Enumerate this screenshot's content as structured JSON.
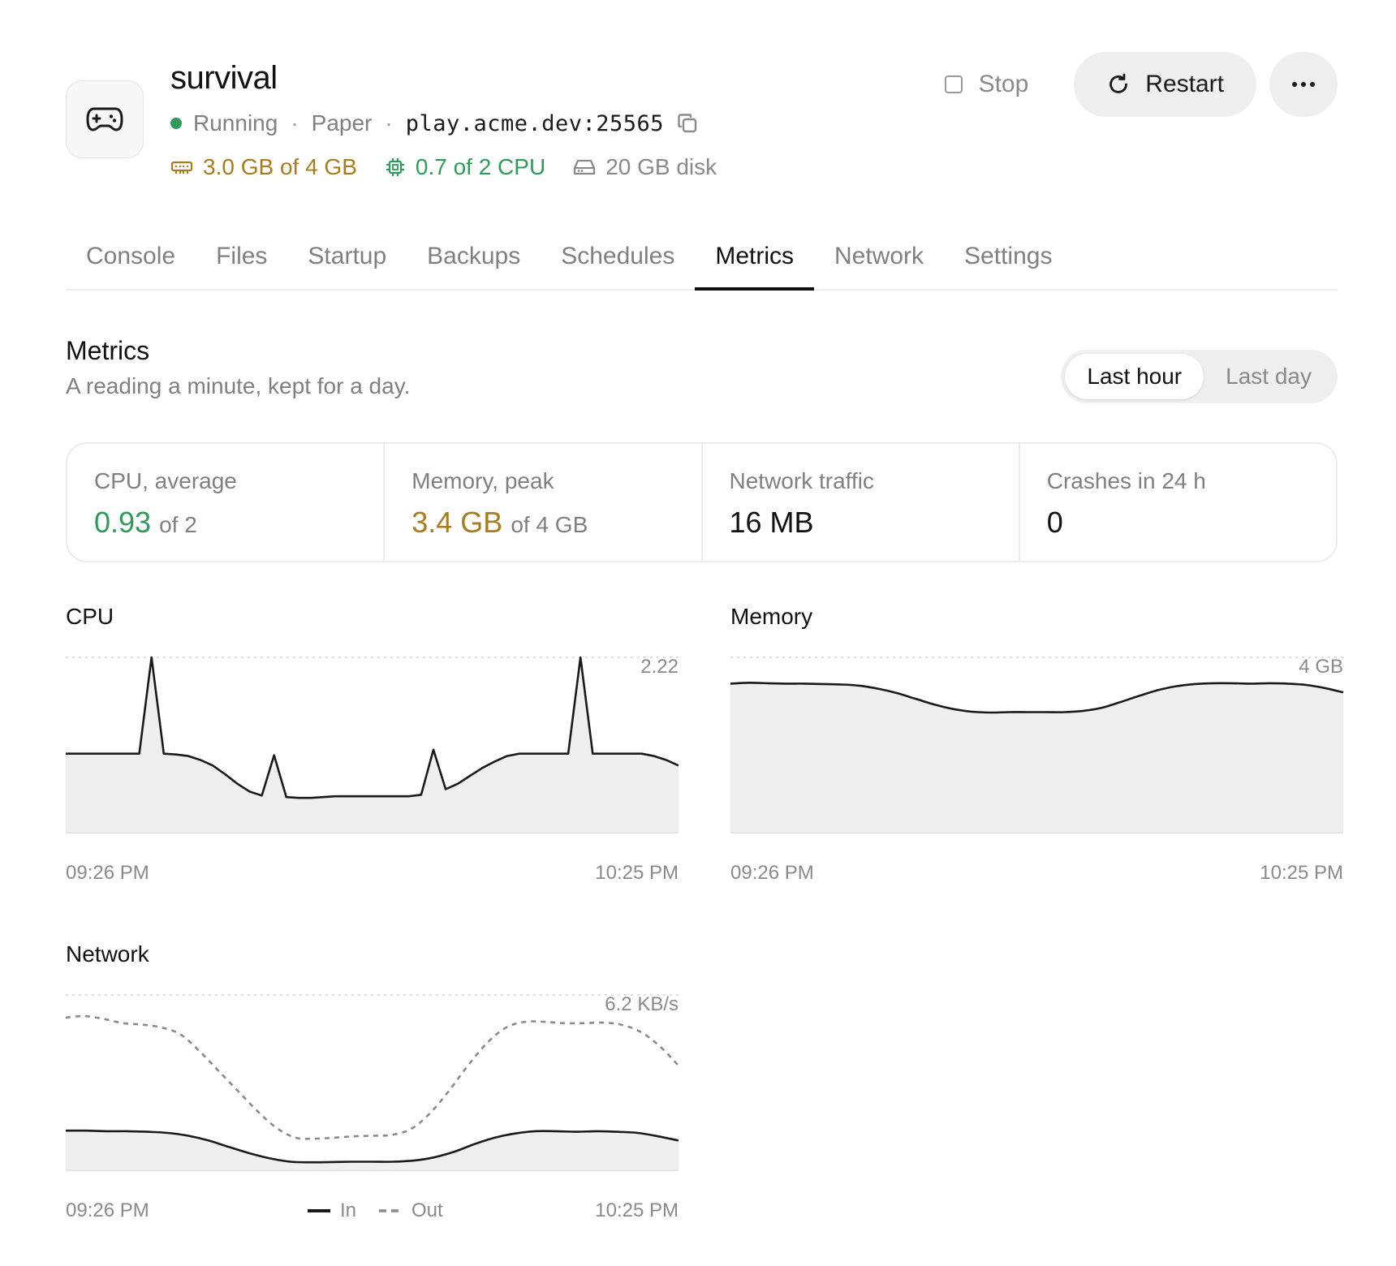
{
  "server": {
    "title": "survival",
    "status": "Running",
    "software": "Paper",
    "address": "play.acme.dev:25565",
    "separator": "·"
  },
  "resources": {
    "memory": "3.0 GB of 4 GB",
    "cpu": "0.7 of 2 CPU",
    "disk": "20 GB disk"
  },
  "actions": {
    "stop_label": "Stop",
    "restart_label": "Restart"
  },
  "tabs": [
    {
      "label": "Console"
    },
    {
      "label": "Files"
    },
    {
      "label": "Startup"
    },
    {
      "label": "Backups"
    },
    {
      "label": "Schedules"
    },
    {
      "label": "Metrics",
      "active": true
    },
    {
      "label": "Network"
    },
    {
      "label": "Settings"
    }
  ],
  "section": {
    "title": "Metrics",
    "subtitle": "A reading a minute, kept for a day.",
    "ranges": [
      "Last hour",
      "Last day"
    ],
    "active_range": "Last hour"
  },
  "stats": [
    {
      "label": "CPU, average",
      "value": "0.93",
      "suffix": "of 2",
      "color": "#2e9b5a"
    },
    {
      "label": "Memory, peak",
      "value": "3.4 GB",
      "suffix": "of 4 GB",
      "color": "#a97c1f"
    },
    {
      "label": "Network traffic",
      "value": "16 MB"
    },
    {
      "label": "Crashes in 24 h",
      "value": "0"
    }
  ],
  "colors": {
    "running": "#2e9b5a",
    "memory": "#a97c1f",
    "cpu": "#2e9b5a",
    "chart_fill": "#efefef",
    "chart_line": "#1a1a1a"
  },
  "chart_data": [
    {
      "type": "area",
      "title": "CPU",
      "max_label": "2.22",
      "x_start": "09:26 PM",
      "x_end": "10:25 PM",
      "ylim": [
        0,
        2.22
      ],
      "values": [
        1.0,
        1.0,
        1.0,
        1.0,
        1.0,
        1.0,
        1.0,
        2.22,
        1.0,
        0.99,
        0.97,
        0.92,
        0.85,
        0.74,
        0.62,
        0.52,
        0.47,
        0.98,
        0.45,
        0.44,
        0.44,
        0.45,
        0.46,
        0.46,
        0.46,
        0.46,
        0.46,
        0.46,
        0.46,
        0.48,
        1.05,
        0.55,
        0.62,
        0.72,
        0.82,
        0.9,
        0.97,
        1.0,
        1.0,
        1.0,
        1.0,
        1.0,
        2.22,
        1.0,
        1.0,
        1.0,
        1.0,
        1.0,
        0.97,
        0.92,
        0.85
      ]
    },
    {
      "type": "area",
      "title": "Memory",
      "max_label": "4 GB",
      "x_start": "09:26 PM",
      "x_end": "10:25 PM",
      "ylim": [
        0,
        4
      ],
      "values": [
        3.4,
        3.42,
        3.41,
        3.4,
        3.4,
        3.39,
        3.38,
        3.35,
        3.28,
        3.18,
        3.05,
        2.92,
        2.82,
        2.76,
        2.74,
        2.75,
        2.75,
        2.75,
        2.75,
        2.78,
        2.85,
        2.98,
        3.12,
        3.25,
        3.34,
        3.39,
        3.41,
        3.41,
        3.4,
        3.41,
        3.4,
        3.37,
        3.3,
        3.2
      ]
    },
    {
      "type": "line",
      "title": "Network",
      "max_label": "6.2 KB/s",
      "x_start": "09:26 PM",
      "x_end": "10:25 PM",
      "ylim": [
        0,
        6.2
      ],
      "series": [
        {
          "name": "In",
          "style": "solid",
          "filled": true,
          "values": [
            1.4,
            1.4,
            1.38,
            1.38,
            1.36,
            1.32,
            1.22,
            1.05,
            0.82,
            0.6,
            0.42,
            0.3,
            0.28,
            0.29,
            0.3,
            0.3,
            0.3,
            0.34,
            0.45,
            0.65,
            0.92,
            1.15,
            1.3,
            1.38,
            1.38,
            1.36,
            1.38,
            1.36,
            1.32,
            1.2,
            1.05
          ]
        },
        {
          "name": "Out",
          "style": "dashed",
          "values": [
            5.4,
            5.45,
            5.35,
            5.2,
            5.15,
            5.05,
            4.8,
            4.2,
            3.5,
            2.8,
            2.1,
            1.5,
            1.15,
            1.12,
            1.15,
            1.2,
            1.22,
            1.25,
            1.45,
            2.0,
            2.8,
            3.7,
            4.5,
            5.05,
            5.25,
            5.25,
            5.2,
            5.2,
            5.22,
            5.15,
            4.9,
            4.4,
            3.7
          ]
        }
      ]
    }
  ]
}
